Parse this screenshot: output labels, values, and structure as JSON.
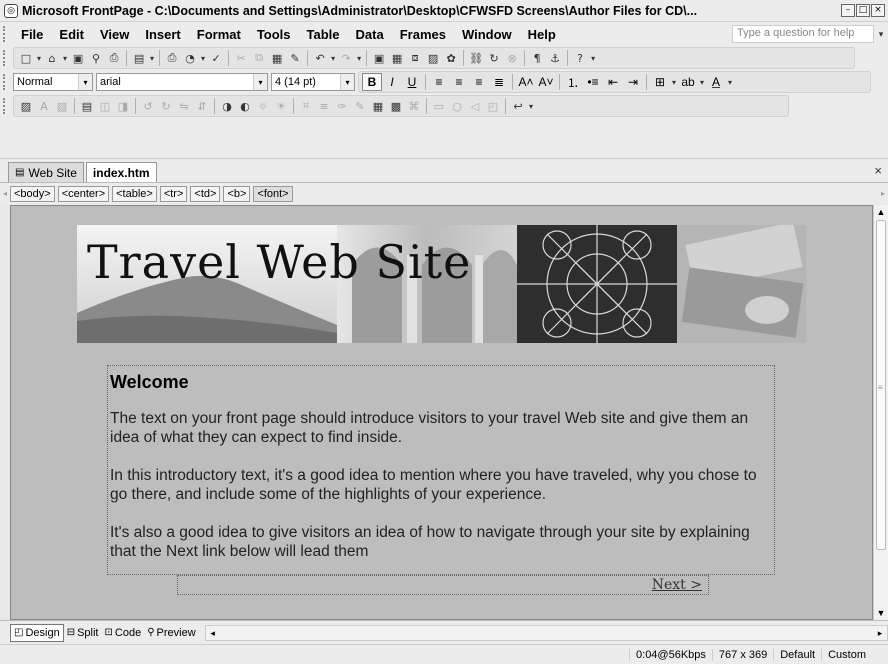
{
  "window": {
    "title": "Microsoft FrontPage - C:\\Documents and Settings\\Administrator\\Desktop\\CFWSFD Screens\\Author Files for CD\\..."
  },
  "menu": {
    "items": [
      "File",
      "Edit",
      "View",
      "Insert",
      "Format",
      "Tools",
      "Table",
      "Data",
      "Frames",
      "Window",
      "Help"
    ],
    "question_placeholder": "Type a question for help"
  },
  "formatting": {
    "style": "Normal",
    "font": "arial",
    "size": "4 (14 pt)"
  },
  "tabs": [
    {
      "label": "Web Site"
    },
    {
      "label": "index.htm"
    }
  ],
  "tag_path": [
    "<body>",
    "<center>",
    "<table>",
    "<tr>",
    "<td>",
    "<b>",
    "<font>"
  ],
  "page": {
    "banner_title": "Travel Web Site",
    "heading": "Welcome",
    "paragraphs": [
      "The text on your front page should introduce visitors to your travel Web site and give them an idea of what they can expect to find inside.",
      "In this introductory text, it's a good idea to mention where you have traveled, why you chose to go there, and include some of the highlights of your experience.",
      "It's also a good idea to give visitors an idea of how to navigate through your site by explaining that the Next link below will lead them"
    ],
    "next_link": "Next >"
  },
  "view_modes": [
    "Design",
    "Split",
    "Code",
    "Preview"
  ],
  "status": {
    "download": "0:04@56Kbps",
    "page_size": "767 x 369",
    "mode1": "Default",
    "mode2": "Custom"
  },
  "icons": {
    "winbtn_min": "minimize-icon",
    "winbtn_max": "maximize-icon",
    "winbtn_close": "close-icon"
  }
}
